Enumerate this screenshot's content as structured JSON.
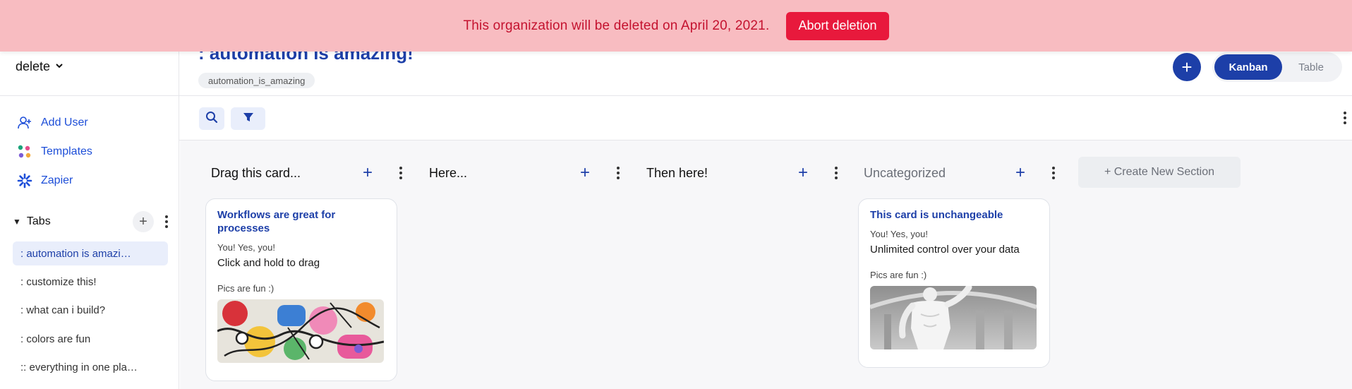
{
  "banner": {
    "message": "This organization will be deleted on April 20, 2021.",
    "abort_label": "Abort deletion",
    "bg_color": "#f8bcc1",
    "button_color": "#e8193c"
  },
  "sidebar": {
    "org_name": "delete",
    "links": [
      {
        "label": "Add User",
        "icon": "add-user-icon"
      },
      {
        "label": "Templates",
        "icon": "templates-icon"
      },
      {
        "label": "Zapier",
        "icon": "zapier-icon"
      }
    ],
    "tabs_label": "Tabs",
    "tabs": [
      {
        "label": ": automation is amazi…",
        "active": true
      },
      {
        "label": ": customize this!",
        "active": false
      },
      {
        "label": ": what can i build?",
        "active": false
      },
      {
        "label": ": colors are fun",
        "active": false
      },
      {
        "label": ":: everything in one pla…",
        "active": false
      }
    ]
  },
  "header": {
    "title": ": automation is amazing!",
    "tag": "automation_is_amazing",
    "views": {
      "kanban": "Kanban",
      "table": "Table",
      "active": "Kanban"
    },
    "accent_color": "#1d3fa8"
  },
  "board": {
    "columns": [
      {
        "name": "Drag this card..."
      },
      {
        "name": "Here..."
      },
      {
        "name": "Then here!"
      },
      {
        "name": "Uncategorized"
      }
    ],
    "create_section_label": "+ Create New Section",
    "cards": [
      {
        "title": "Workflows are great for processes",
        "sub_label": "You! Yes, you!",
        "value": "Click and hold to drag",
        "pics_label": "Pics are fun :)",
        "picture": "colorful-doodle-art"
      },
      {
        "title": "This card is unchangeable",
        "sub_label": "You! Yes, you!",
        "value": "Unlimited control over your data",
        "pics_label": "Pics are fun :)",
        "picture": "marble-statue"
      }
    ]
  }
}
